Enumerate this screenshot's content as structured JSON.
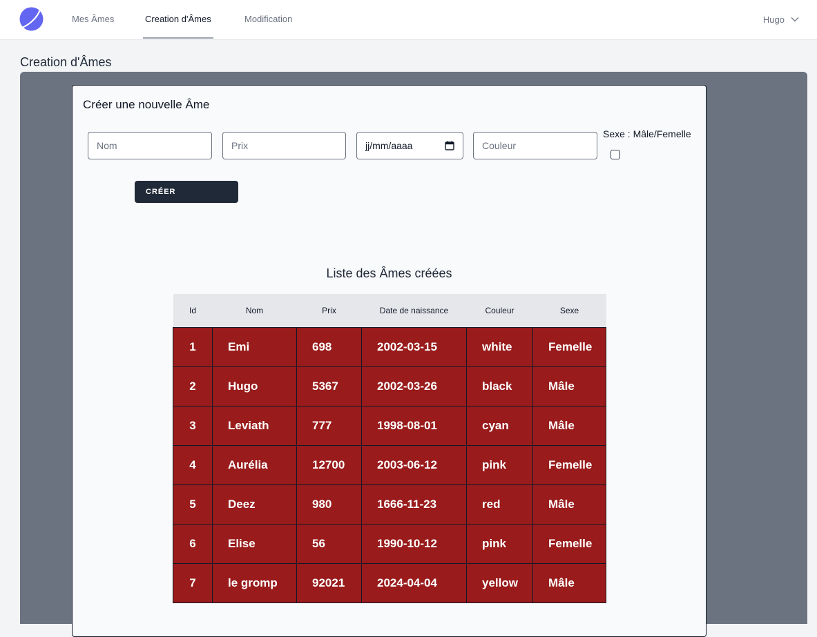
{
  "nav": {
    "links": [
      "Mes Âmes",
      "Creation d'Âmes",
      "Modification"
    ],
    "user": "Hugo"
  },
  "page": {
    "title": "Creation d'Âmes"
  },
  "form": {
    "title": "Créer une nouvelle Âme",
    "nom_placeholder": "Nom",
    "prix_placeholder": "Prix",
    "date_placeholder": "jj/mm/aaaa",
    "couleur_placeholder": "Couleur",
    "sexe_label": "Sexe : Mâle/Femelle",
    "create_label": "CRÉER"
  },
  "list": {
    "title": "Liste des Âmes créées",
    "headers": [
      "Id",
      "Nom",
      "Prix",
      "Date de naissance",
      "Couleur",
      "Sexe"
    ],
    "rows": [
      [
        "1",
        "Emi",
        "698",
        "2002-03-15",
        "white",
        "Femelle"
      ],
      [
        "2",
        "Hugo",
        "5367",
        "2002-03-26",
        "black",
        "Mâle"
      ],
      [
        "3",
        "Leviath",
        "777",
        "1998-08-01",
        "cyan",
        "Mâle"
      ],
      [
        "4",
        "Aurélia",
        "12700",
        "2003-06-12",
        "pink",
        "Femelle"
      ],
      [
        "5",
        "Deez",
        "980",
        "1666-11-23",
        "red",
        "Mâle"
      ],
      [
        "6",
        "Elise",
        "56",
        "1990-10-12",
        "pink",
        "Femelle"
      ],
      [
        "7",
        "le gromp",
        "92021",
        "2024-04-04",
        "yellow",
        "Mâle"
      ]
    ]
  },
  "colors": {
    "row_bg": "#991b1b",
    "panel": "#6b7280",
    "button": "#1f2937",
    "logo": "#6366f1"
  }
}
